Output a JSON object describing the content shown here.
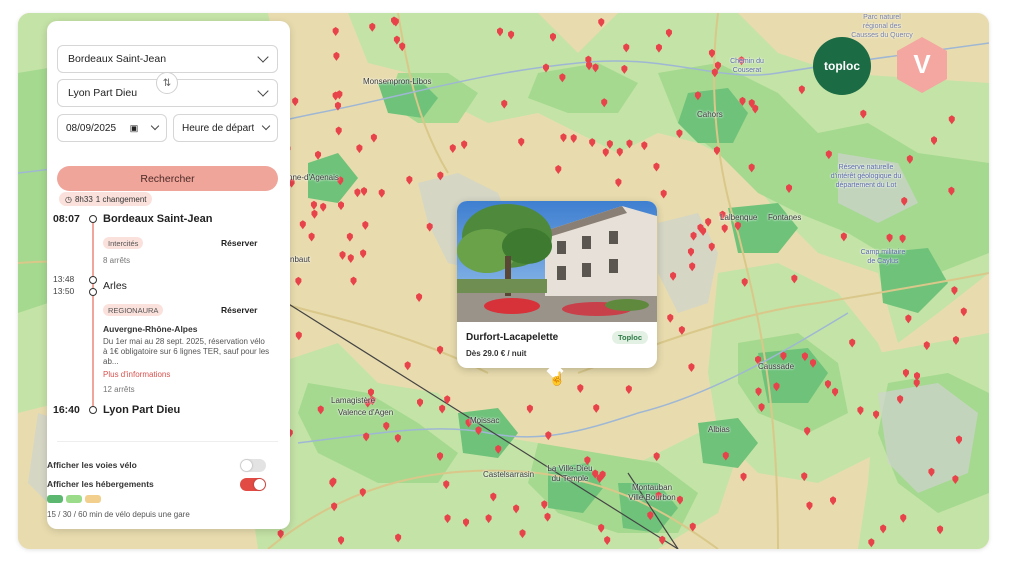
{
  "map": {
    "places": [
      {
        "name": "Monsempron-Libos"
      },
      {
        "name": "Chemin du Couserat"
      },
      {
        "name": "Cahors"
      },
      {
        "name": "nne-d'Agenais"
      },
      {
        "name": "Lalbenque"
      },
      {
        "name": "Fontanes"
      },
      {
        "name": "nbaut"
      },
      {
        "name": "Lamagistère"
      },
      {
        "name": "Valence d'Agen"
      },
      {
        "name": "Moissac"
      },
      {
        "name": "Caussade"
      },
      {
        "name": "Albias"
      },
      {
        "name": "Castelsarrasin"
      },
      {
        "name": "La Ville-Dieu du Temple"
      },
      {
        "name": "Montauban Ville Bourbon"
      },
      {
        "name": "Réserve naturelle d'intérêt géologique du département du Lot"
      },
      {
        "name": "Camp militaire de Caylus"
      },
      {
        "name": "Parc naturel régional des Causses du Quercy"
      }
    ],
    "colors": {
      "light_green": "#b9dea0",
      "mid_green": "#8fcf86",
      "dark_green": "#5cb86f",
      "tan": "#e8dcae",
      "pin": "#e8424b"
    }
  },
  "logos": {
    "toploc": "toploc",
    "v": "V"
  },
  "panel": {
    "origin": "Bordeaux Saint-Jean",
    "destination": "Lyon Part Dieu",
    "date": "08/09/2025",
    "time_placeholder": "Heure de départ",
    "search_label": "Rechercher",
    "duration": "8h33",
    "changes": "1 changement",
    "journey": {
      "start_time": "08:07",
      "start_station": "Bordeaux Saint-Jean",
      "leg1_operator": "Intercités",
      "leg1_reserve": "Réserver",
      "leg1_stops": "8 arrêts",
      "arles_arr": "13:48",
      "arles_dep": "13:50",
      "arles": "Arles",
      "leg2_operator": "REGIONAURA",
      "leg2_reserve": "Réserver",
      "leg2_region": "Auvergne-Rhône-Alpes",
      "leg2_note": "Du 1er mai au 28 sept. 2025, réservation vélo à 1€ obligatoire sur 6 lignes TER, sauf pour les ab...",
      "leg2_more": "Plus d'informations",
      "leg2_stops": "12 arrêts",
      "end_time": "16:40",
      "end_station": "Lyon Part Dieu"
    },
    "toggle_bike_lanes": "Afficher les voies vélo",
    "toggle_lodging": "Afficher les hébergements",
    "bike_lanes_on": false,
    "lodging_on": true,
    "legend_colors": [
      "#5cb86f",
      "#9bdc8a",
      "#f2cf8c"
    ],
    "legend_text": "15 / 30 / 60 min de vélo depuis une gare"
  },
  "popup": {
    "name": "Durfort-Lacapelette",
    "price": "Dès 29.0 € / nuit",
    "provider": "Toploc"
  }
}
